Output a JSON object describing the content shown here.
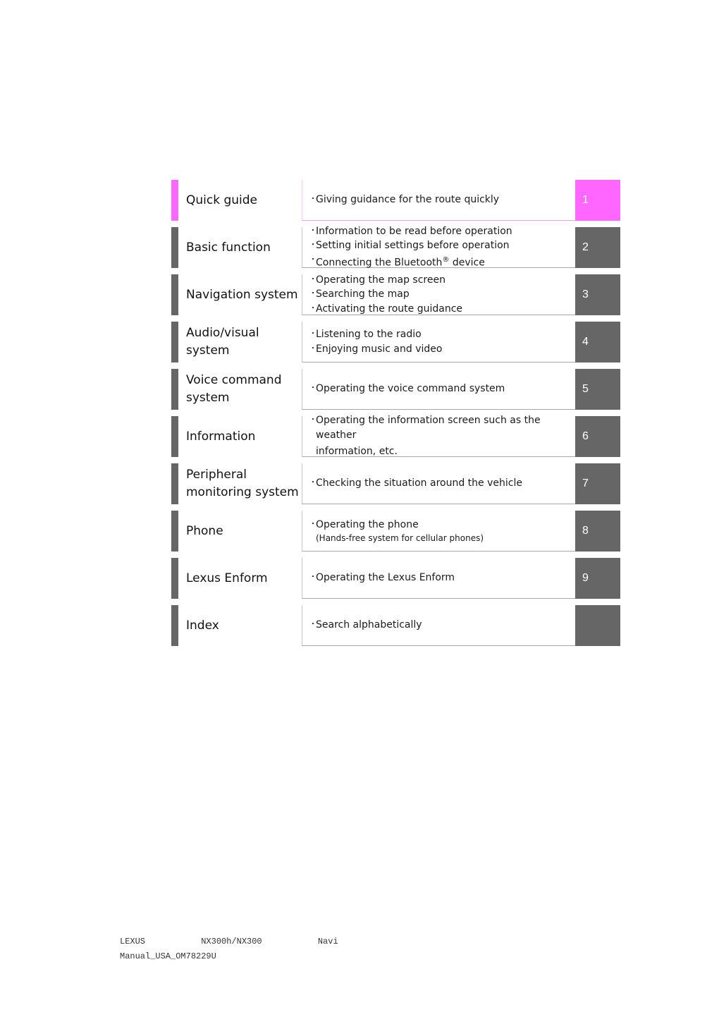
{
  "accent_color": "#ff66ff",
  "tab_color": "#666666",
  "sections": [
    {
      "title": [
        "Quick guide"
      ],
      "items": [
        "Giving guidance for the route quickly"
      ],
      "tab": "1"
    },
    {
      "title": [
        "Basic function"
      ],
      "items": [
        "Information to be read before operation",
        "Setting initial settings before operation",
        "Connecting the Bluetooth® device"
      ],
      "tab": "2"
    },
    {
      "title": [
        "Navigation system"
      ],
      "items": [
        "Operating the map screen",
        "Searching the map",
        "Activating the route guidance"
      ],
      "tab": "3"
    },
    {
      "title": [
        "Audio/visual",
        "system"
      ],
      "items": [
        "Listening to the radio",
        "Enjoying music and video"
      ],
      "tab": "4"
    },
    {
      "title": [
        "Voice command",
        "system"
      ],
      "items": [
        "Operating the voice command system"
      ],
      "tab": "5"
    },
    {
      "title": [
        "Information"
      ],
      "items": [
        "Operating the information screen such as the weather"
      ],
      "continuation": "information, etc.",
      "tab": "6"
    },
    {
      "title": [
        "Peripheral",
        "monitoring system"
      ],
      "items": [
        "Checking the situation around the vehicle"
      ],
      "tab": "7"
    },
    {
      "title": [
        "Phone"
      ],
      "items": [
        "Operating the phone"
      ],
      "subnote": "(Hands-free system for cellular phones)",
      "tab": "8"
    },
    {
      "title": [
        "Lexus Enform"
      ],
      "items": [
        "Operating the Lexus Enform"
      ],
      "tab": "9"
    },
    {
      "title": [
        "Index"
      ],
      "items": [
        "Search alphabetically"
      ],
      "tab": ""
    }
  ],
  "bullet_char": "・",
  "footer": {
    "line1": "LEXUS           NX300h/NX300           Navi",
    "line2": "Manual_USA_OM78229U"
  }
}
